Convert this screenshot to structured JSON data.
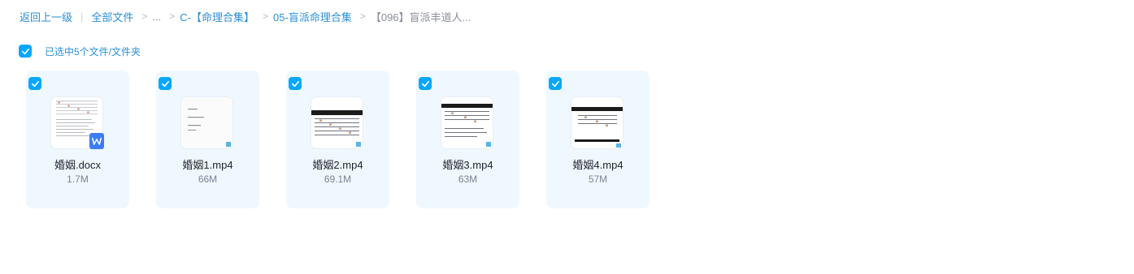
{
  "breadcrumb": {
    "back": "返回上一级",
    "all_files": "全部文件",
    "ellipsis": "...",
    "folder1": "C-【命理合集】",
    "folder2": "05-盲派命理合集",
    "current": "【096】盲派丰道人...",
    "separator": ">"
  },
  "selection": {
    "checked": true,
    "label": "已选中5个文件/文件夹"
  },
  "files": [
    {
      "name": "婚姻.docx",
      "size": "1.7M",
      "type": "docx",
      "checked": true,
      "thumb": "document"
    },
    {
      "name": "婚姻1.mp4",
      "size": "66M",
      "type": "mp4",
      "checked": true,
      "thumb": "video-white"
    },
    {
      "name": "婚姻2.mp4",
      "size": "69.1M",
      "type": "mp4",
      "checked": true,
      "thumb": "video-table"
    },
    {
      "name": "婚姻3.mp4",
      "size": "63M",
      "type": "mp4",
      "checked": true,
      "thumb": "video-table"
    },
    {
      "name": "婚姻4.mp4",
      "size": "57M",
      "type": "mp4",
      "checked": true,
      "thumb": "video-table"
    }
  ],
  "colors": {
    "accent": "#06a7ff",
    "link": "#2b8fd6",
    "card_bg": "#eff8fe",
    "word_badge": "#3d7cf6"
  },
  "icons": {
    "checkbox": "check-icon",
    "word": "word-doc-icon"
  }
}
